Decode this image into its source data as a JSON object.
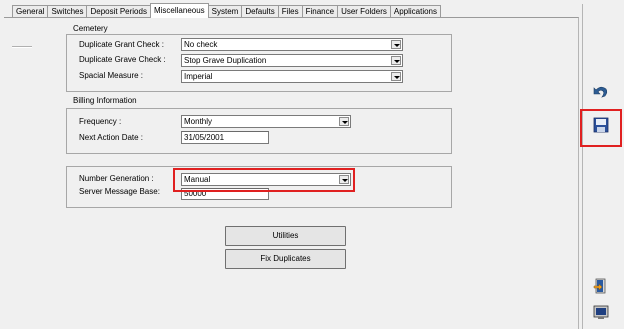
{
  "tabs": [
    {
      "label": "General"
    },
    {
      "label": "Switches"
    },
    {
      "label": "Deposit Periods"
    },
    {
      "label": "Miscellaneous"
    },
    {
      "label": "System"
    },
    {
      "label": "Defaults"
    },
    {
      "label": "Files"
    },
    {
      "label": "Finance"
    },
    {
      "label": "User Folders"
    },
    {
      "label": "Applications"
    }
  ],
  "active_tab": "Miscellaneous",
  "cemetery": {
    "title": "Cemetery",
    "duplicate_grant_label": "Duplicate Grant Check :",
    "duplicate_grant_value": "No check",
    "duplicate_grave_label": "Duplicate Grave Check :",
    "duplicate_grave_value": "Stop Grave Duplication",
    "spacial_label": "Spacial Measure :",
    "spacial_value": "Imperial"
  },
  "billing": {
    "title": "Billing Information",
    "frequency_label": "Frequency :",
    "frequency_value": "Monthly",
    "next_action_label": "Next Action Date :",
    "next_action_value": "31/05/2001"
  },
  "numbering": {
    "number_generation_label": "Number Generation :",
    "number_generation_value": "Manual",
    "server_message_label": "Server Message Base:",
    "server_message_value": "50000"
  },
  "buttons": {
    "utilities": "Utilities",
    "fix_duplicates": "Fix Duplicates"
  },
  "icons": {
    "undo": "undo-icon",
    "save": "save-icon",
    "exit": "exit-door-icon",
    "monitor": "monitor-icon"
  },
  "highlight_color": "#e02020"
}
